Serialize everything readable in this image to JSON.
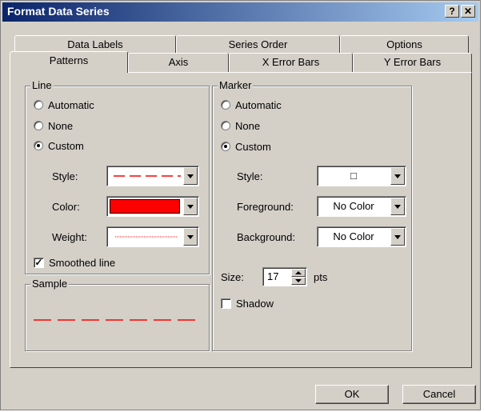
{
  "window": {
    "title": "Format Data Series",
    "help_label": "?",
    "close_label": "✕"
  },
  "tabs_back": [
    "Data Labels",
    "Series Order",
    "Options"
  ],
  "tabs_front": [
    "Patterns",
    "Axis",
    "X Error Bars",
    "Y Error Bars"
  ],
  "line_group": {
    "title": "Line",
    "radios": [
      "Automatic",
      "None",
      "Custom"
    ],
    "selected": "Custom",
    "style_label": "Style:",
    "color_label": "Color:",
    "weight_label": "Weight:",
    "color_value": "#ff0000",
    "smoothed_label": "Smoothed line",
    "smoothed_checked": true
  },
  "sample_group": {
    "title": "Sample"
  },
  "marker_group": {
    "title": "Marker",
    "radios": [
      "Automatic",
      "None",
      "Custom"
    ],
    "selected": "Custom",
    "style_label": "Style:",
    "style_value": "□",
    "foreground_label": "Foreground:",
    "foreground_value": "No Color",
    "background_label": "Background:",
    "background_value": "No Color",
    "size_label": "Size:",
    "size_value": "17",
    "size_unit": "pts",
    "shadow_label": "Shadow",
    "shadow_checked": false
  },
  "buttons": {
    "ok": "OK",
    "cancel": "Cancel"
  }
}
